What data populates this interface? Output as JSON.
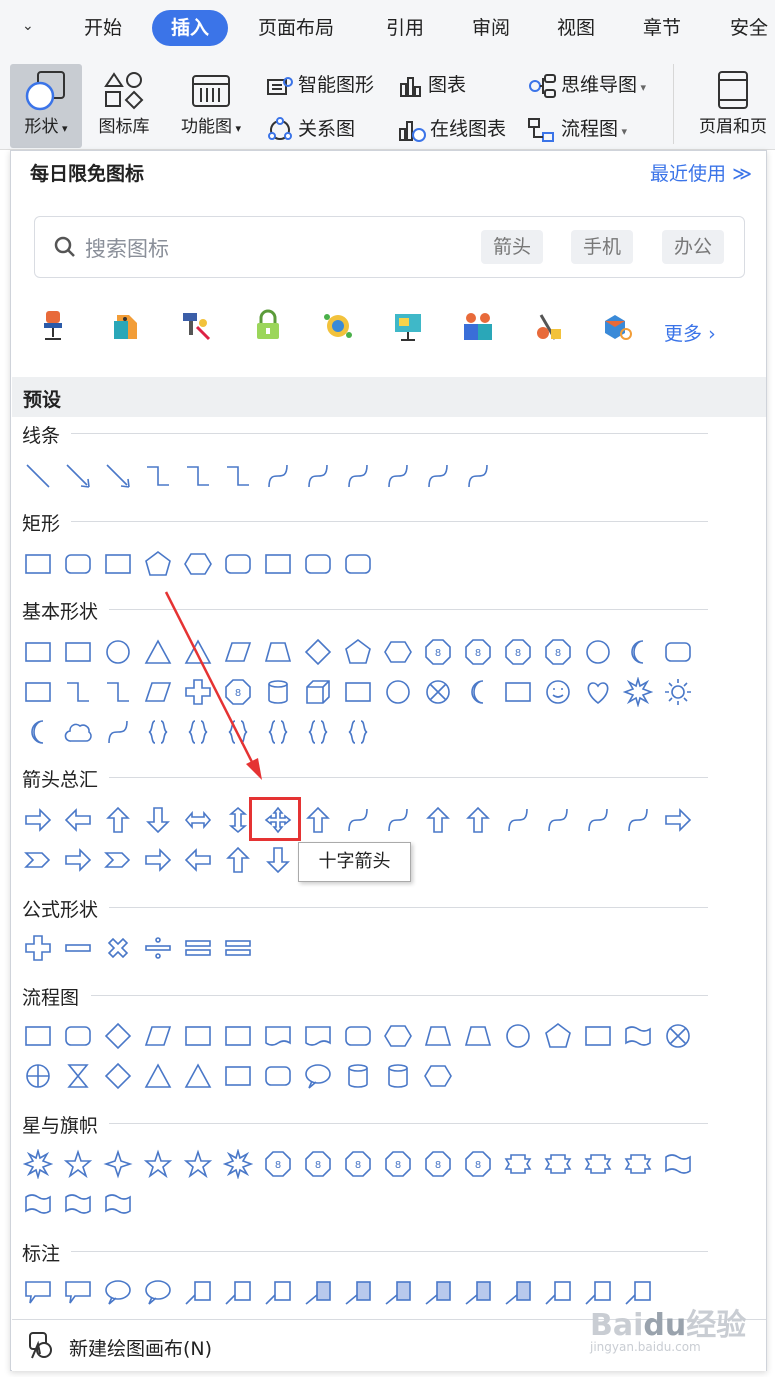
{
  "tabs": {
    "items": [
      "开始",
      "插入",
      "页面布局",
      "引用",
      "审阅",
      "视图",
      "章节",
      "安全"
    ],
    "active": "插入"
  },
  "ribbon": {
    "shape_label": "形状",
    "iconlib_label": "图标库",
    "funcmap_label": "功能图",
    "smartart_label": "智能图形",
    "chart_label": "图表",
    "mindmap_label": "思维导图",
    "relation_label": "关系图",
    "online_chart_label": "在线图表",
    "flowchart_label": "流程图",
    "header_footer_label": "页眉和页"
  },
  "panel": {
    "title": "每日限免图标",
    "recent": "最近使用",
    "search_placeholder": "搜索图标",
    "tags": [
      "箭头",
      "手机",
      "办公"
    ],
    "more": "更多",
    "preset": "预设",
    "categories": {
      "lines": "线条",
      "rect": "矩形",
      "basic": "基本形状",
      "arrows": "箭头总汇",
      "formula": "公式形状",
      "flow": "流程图",
      "stars": "星与旗帜",
      "callout": "标注"
    },
    "tooltip": "十字箭头",
    "new_canvas": "新建绘图画布(N)"
  },
  "watermark": {
    "logo": "Baidu经验",
    "url": "jingyan.baidu.com"
  },
  "colors": {
    "accent": "#3b74e8",
    "shape_stroke": "#4a78c8",
    "highlight": "#e53333"
  }
}
